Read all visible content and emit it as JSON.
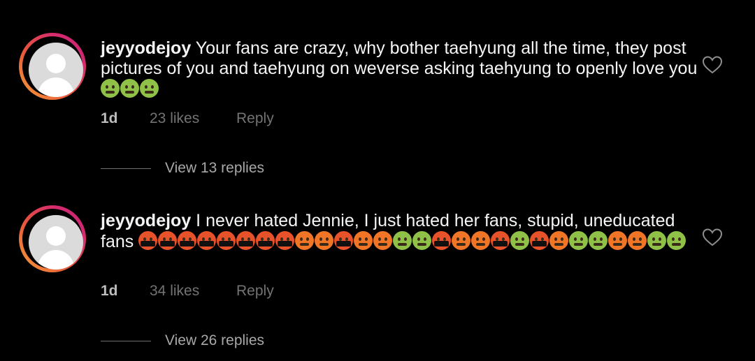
{
  "comments": [
    {
      "username": "jeyyodejoy",
      "text": " Your fans are crazy, why bother taehyung all the time, they post pictures of you and taehyung on weverse asking taehyung to openly love you",
      "emojis": [
        "nauseated-face",
        "nauseated-face",
        "nauseated-face"
      ],
      "time": "1d",
      "likes": "23 likes",
      "reply_label": "Reply",
      "view_replies": "View 13 replies"
    },
    {
      "username": "jeyyodejoy",
      "text": " I never hated Jennie, I just hated her fans, stupid, uneducated fans ",
      "emojis": [
        "cursing-face",
        "cursing-face",
        "cursing-face",
        "cursing-face",
        "cursing-face",
        "cursing-face",
        "cursing-face",
        "cursing-face",
        "angry-face",
        "angry-face",
        "cursing-face",
        "angry-face",
        "angry-face",
        "nauseated-face",
        "nauseated-face",
        "cursing-face",
        "angry-face",
        "angry-face",
        "cursing-face",
        "nauseated-face",
        "cursing-face",
        "angry-face",
        "nauseated-face",
        "nauseated-face",
        "angry-face",
        "angry-face",
        "nauseated-face",
        "nauseated-face"
      ],
      "time": "1d",
      "likes": "34 likes",
      "reply_label": "Reply",
      "view_replies": "View 26 replies"
    }
  ],
  "colors": {
    "background": "#000000",
    "text": "#f5f5f5",
    "muted": "#737373",
    "story_ring_start": "#f6a33a",
    "story_ring_end": "#c21d78"
  },
  "icons": {
    "like": "heart-outline-icon",
    "avatar": "default-avatar-icon"
  }
}
